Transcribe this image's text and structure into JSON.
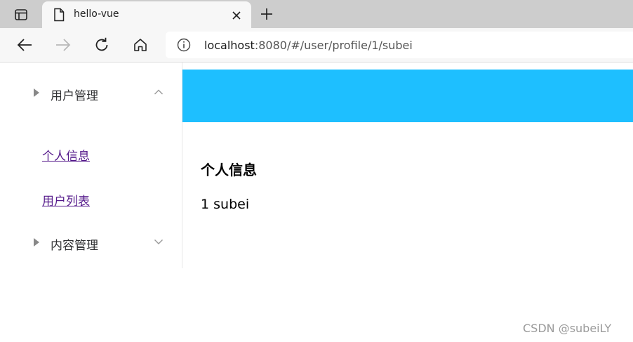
{
  "browser": {
    "tab": {
      "title": "hello-vue"
    },
    "address": {
      "host": "localhost",
      "rest": ":8080/#/user/profile/1/subei"
    }
  },
  "sidebar": {
    "groups": [
      {
        "label": "用户管理",
        "expanded": true,
        "items": [
          "个人信息",
          "用户列表"
        ]
      },
      {
        "label": "内容管理",
        "expanded": false
      }
    ]
  },
  "main": {
    "header_color": "#1ebfff",
    "title": "个人信息",
    "body": "1 subei"
  },
  "watermark": "CSDN @subeiLY"
}
